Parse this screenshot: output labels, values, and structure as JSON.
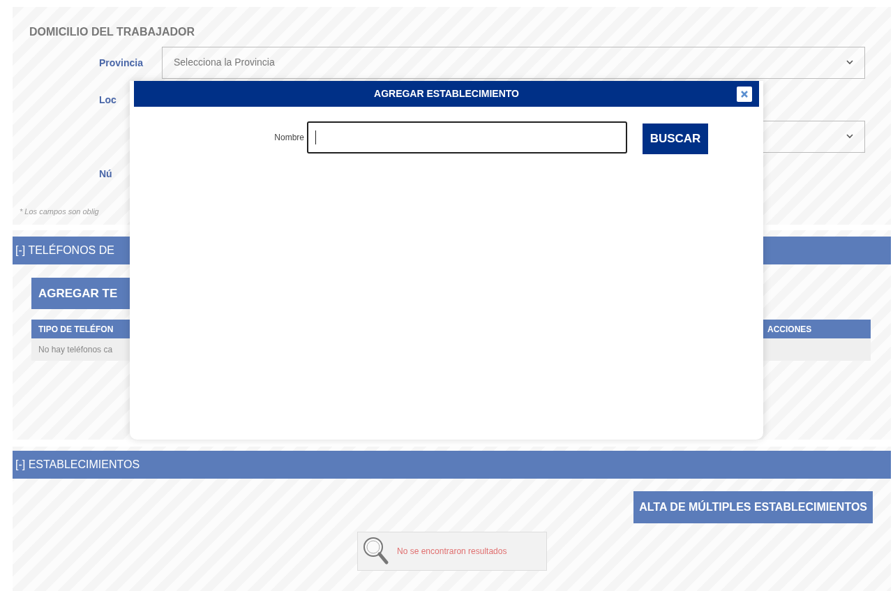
{
  "form_section": {
    "title": "DOMICILIO DEL TRABAJADOR",
    "fields": [
      {
        "kind": "select",
        "label": "Provincia",
        "placeholder": "Selecciona la Provincia"
      },
      {
        "kind": "blank",
        "label": "Loc"
      },
      {
        "kind": "select"
      },
      {
        "kind": "blank",
        "label": "Nú"
      }
    ],
    "note": "* Los campos son oblig"
  },
  "phones": {
    "header": "[-] TELÉFONOS DE",
    "add_button": "AGREGAR TE",
    "columns": [
      "TIPO DE TELÉFON",
      "ACCIONES"
    ],
    "empty": "No hay teléfonos ca"
  },
  "establishments": {
    "header": "[-] ESTABLECIMIENTOS",
    "bulk_button": "ALTA DE MÚLTIPLES ESTABLECIMIENTOS",
    "empty": "No se encontraron resultados"
  },
  "modal": {
    "title": "AGREGAR ESTABLECIMIENTO",
    "field_label": "Nombre",
    "button": "BUSCAR"
  }
}
